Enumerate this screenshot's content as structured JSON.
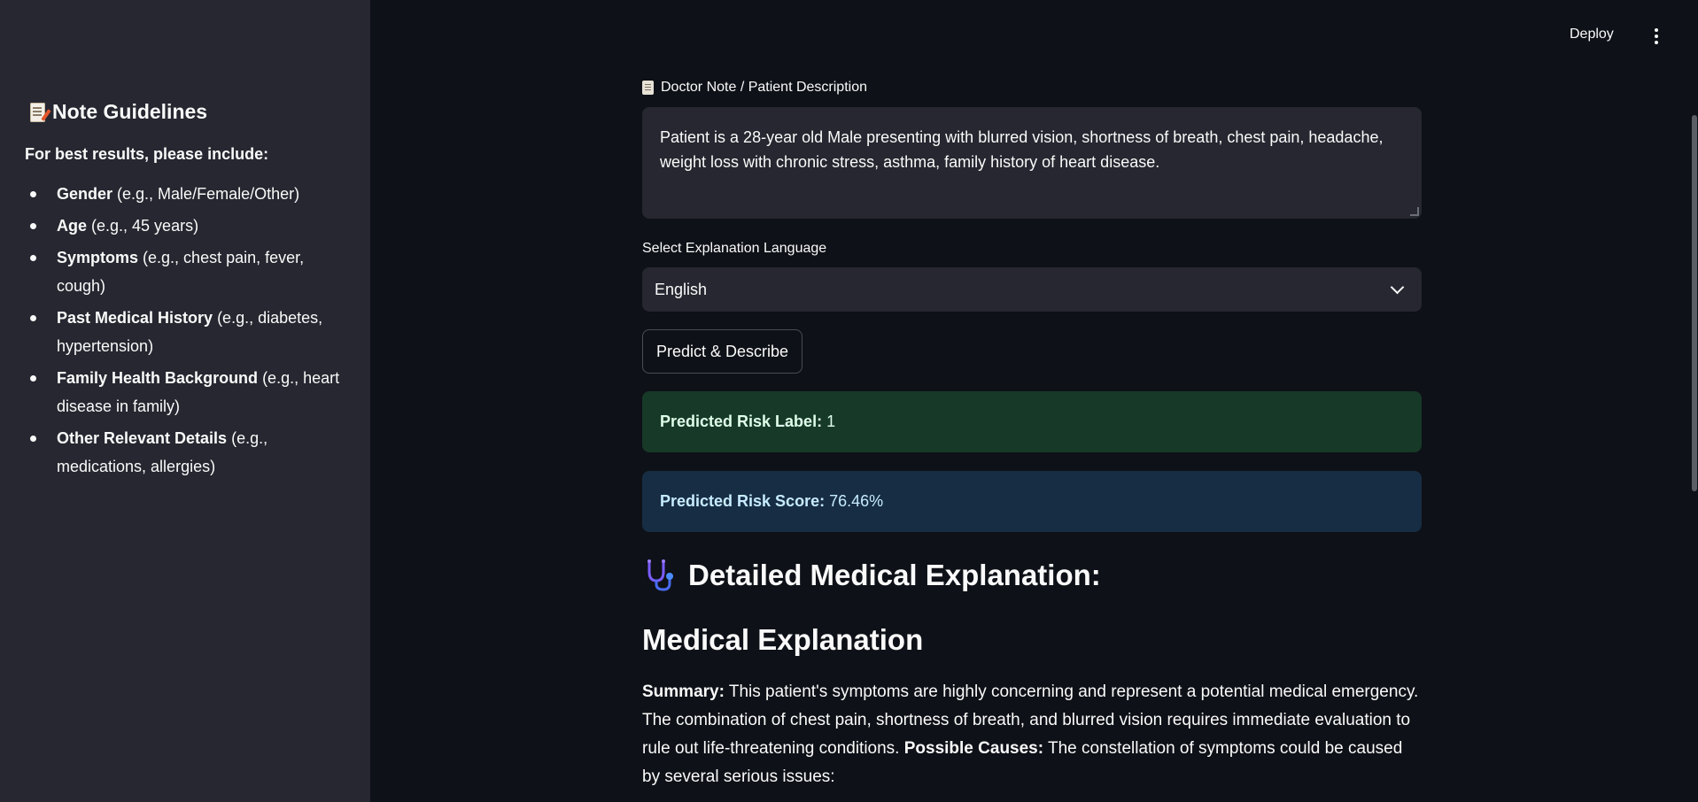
{
  "header": {
    "deploy_label": "Deploy",
    "menu_icon": "vertical-dots-icon"
  },
  "sidebar": {
    "title": "Note Guidelines",
    "title_icon": "memo-icon",
    "intro": "For best results, please include:",
    "items": [
      {
        "bold": "Gender",
        "rest": " (e.g., Male/Female/Other)"
      },
      {
        "bold": "Age",
        "rest": " (e.g., 45 years)"
      },
      {
        "bold": "Symptoms",
        "rest": " (e.g., chest pain, fever, cough)"
      },
      {
        "bold": "Past Medical History",
        "rest": " (e.g., diabetes, hypertension)"
      },
      {
        "bold": "Family Health Background",
        "rest": " (e.g., heart disease in family)"
      },
      {
        "bold": "Other Relevant Details",
        "rest": " (e.g., medications, allergies)"
      }
    ]
  },
  "form": {
    "note_label": "Doctor Note / Patient Description",
    "note_icon": "scroll-icon",
    "note_value": "Patient is a 28-year old Male presenting with blurred vision, shortness of breath, chest pain, headache, weight loss with chronic stress, asthma, family history of heart disease.",
    "language_label": "Select Explanation Language",
    "language_value": "English",
    "predict_button": "Predict & Describe"
  },
  "results": {
    "label_title": "Predicted Risk Label:",
    "label_value": "1",
    "score_title": "Predicted Risk Score:",
    "score_value": "76.46%"
  },
  "explanation": {
    "heading": "Detailed Medical Explanation:",
    "heading_icon": "stethoscope-icon",
    "subheading": "Medical Explanation",
    "summary_label": "Summary:",
    "summary_text": " This patient's symptoms are highly concerning and represent a potential medical emergency. The combination of chest pain, shortness of breath, and blurred vision requires immediate evaluation to rule out life-threatening conditions. ",
    "causes_label": "Possible Causes:",
    "causes_text": " The constellation of symptoms could be caused by several serious issues:"
  },
  "colors": {
    "background": "#0e1117",
    "sidebar": "#262730",
    "success_bg": "#173928",
    "info_bg": "#172d43"
  }
}
